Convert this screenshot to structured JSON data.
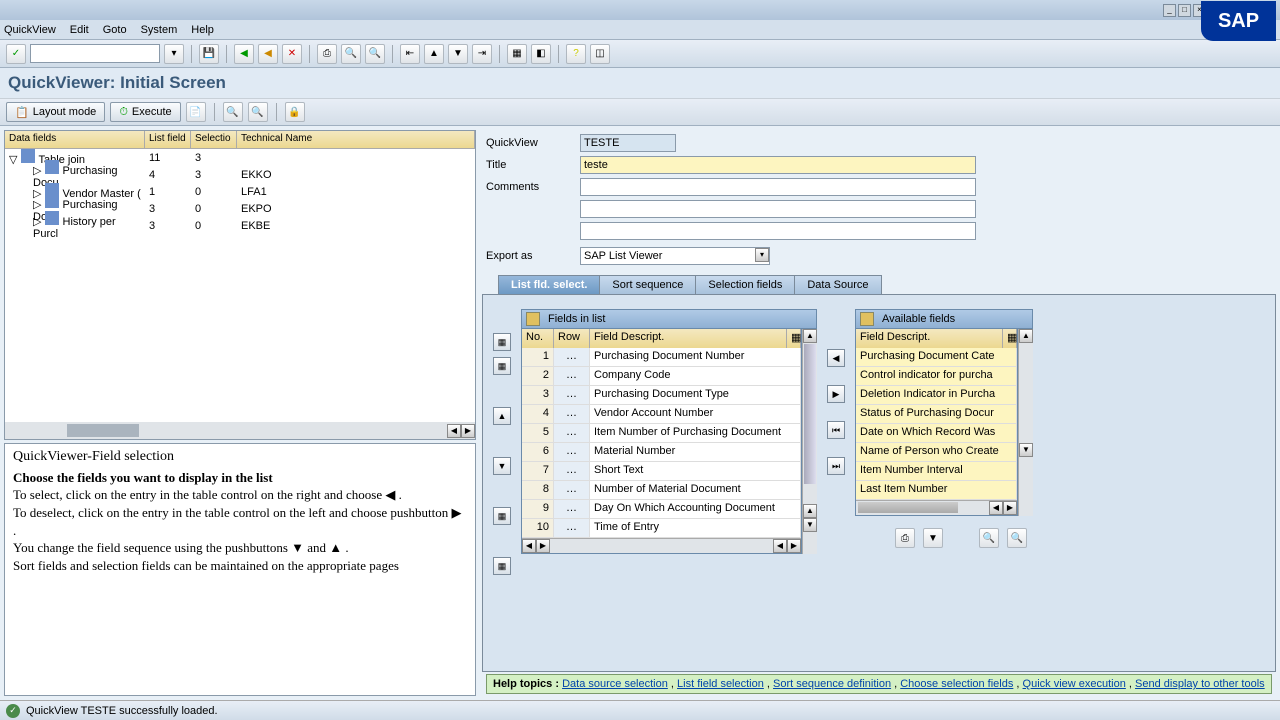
{
  "menu": {
    "m1": "QuickView",
    "m2": "Edit",
    "m3": "Goto",
    "m4": "System",
    "m5": "Help"
  },
  "page_title": "QuickViewer: Initial Screen",
  "app_toolbar": {
    "layout": "Layout mode",
    "execute": "Execute"
  },
  "tree": {
    "hdr": {
      "c1": "Data fields",
      "c2": "List field",
      "c3": "Selectio",
      "c4": "Technical Name"
    },
    "root": "Table join",
    "root_lf": "11",
    "root_sel": "3",
    "rows": [
      {
        "name": "Purchasing Docu",
        "lf": "4",
        "sel": "3",
        "tn": "EKKO"
      },
      {
        "name": "Vendor Master (",
        "lf": "1",
        "sel": "0",
        "tn": "LFA1"
      },
      {
        "name": "Purchasing Docu",
        "lf": "3",
        "sel": "0",
        "tn": "EKPO"
      },
      {
        "name": "History per Purcl",
        "lf": "3",
        "sel": "0",
        "tn": "EKBE"
      }
    ]
  },
  "help": {
    "title": "QuickViewer-Field selection",
    "bold": "Choose the fields you want to display in the list",
    "l1": "To select, click on the entry in the table control on the right and choose ◀ .",
    "l2": "To deselect, click on the entry in the table control on the left and choose pushbutton ▶ .",
    "l3": "You change the field sequence using the pushbuttons ▼ and ▲ .",
    "l4": "Sort fields and selection fields can be maintained on the appropriate pages"
  },
  "form": {
    "quickview_lbl": "QuickView",
    "quickview_val": "TESTE",
    "title_lbl": "Title",
    "title_val": "teste",
    "comments_lbl": "Comments",
    "export_lbl": "Export as",
    "export_val": "SAP List Viewer"
  },
  "tabs": {
    "t1": "List fld. select.",
    "t2": "Sort sequence",
    "t3": "Selection fields",
    "t4": "Data Source"
  },
  "fields_list": {
    "title": "Fields in list",
    "hdr": {
      "no": "No.",
      "row": "Row",
      "desc": "Field Descript."
    },
    "rows": [
      {
        "n": "1",
        "d": "Purchasing Document Number"
      },
      {
        "n": "2",
        "d": "Company Code"
      },
      {
        "n": "3",
        "d": "Purchasing Document Type"
      },
      {
        "n": "4",
        "d": "Vendor Account Number"
      },
      {
        "n": "5",
        "d": "Item Number of Purchasing Document"
      },
      {
        "n": "6",
        "d": "Material Number"
      },
      {
        "n": "7",
        "d": "Short Text"
      },
      {
        "n": "8",
        "d": "Number of Material Document"
      },
      {
        "n": "9",
        "d": "Day On Which Accounting Document"
      },
      {
        "n": "10",
        "d": "Time of Entry"
      }
    ]
  },
  "avail": {
    "title": "Available fields",
    "hdr": "Field Descript.",
    "rows": [
      "Purchasing Document Cate",
      "Control indicator for purcha",
      "Deletion Indicator in Purcha",
      "Status of Purchasing Docur",
      "Date on Which Record Was",
      "Name of Person who Create",
      "Item Number Interval",
      "Last Item Number"
    ]
  },
  "helpbar": {
    "label": "Help topics :",
    "links": [
      "Data source selection",
      "List field selection",
      "Sort sequence definition",
      "Choose selection fields",
      "Quick view execution",
      "Send display to other tools"
    ]
  },
  "status": "QuickView TESTE successfully loaded."
}
